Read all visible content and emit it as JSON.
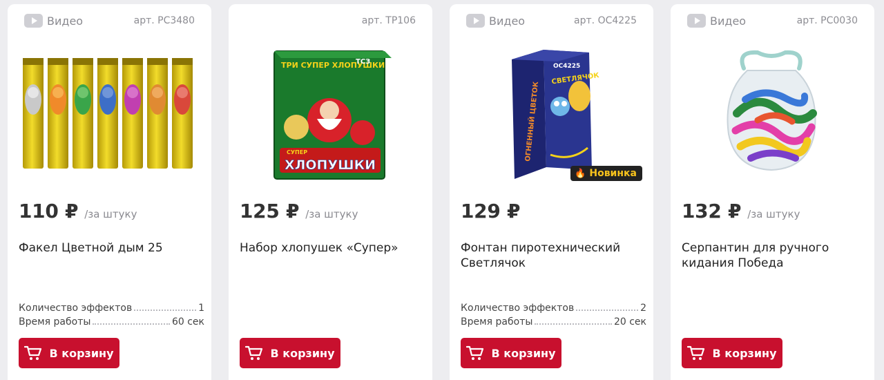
{
  "products": [
    {
      "video_label": "Видео",
      "has_video": true,
      "article": "арт. РС3480",
      "price": "110 ₽",
      "per_unit": "/за штуку",
      "title": "Факел Цветной дым 25",
      "specs": [
        {
          "label": "Количество эффектов",
          "value": "1"
        },
        {
          "label": "Время работы",
          "value": "60 сек"
        }
      ],
      "cart_label": "В корзину",
      "image_icon": "smoke-torches-image"
    },
    {
      "video_label": "",
      "has_video": false,
      "article": "арт. ТР106",
      "price": "125 ₽",
      "per_unit": "/за штуку",
      "title": "Набор хлопушек «Супер»",
      "specs": [],
      "cart_label": "В корзину",
      "image_icon": "party-poppers-box-image",
      "image_text": {
        "top": "ТРИ СУПЕР ХЛОПУШКИ",
        "brand": "ТСЗ",
        "bottom": "ХЛОПУШКИ",
        "sub": "СУПЕР"
      }
    },
    {
      "video_label": "Видео",
      "has_video": true,
      "article": "арт. ОС4225",
      "price": "129 ₽",
      "per_unit": "",
      "title": "Фонтан пиротехнический Светлячок",
      "badge": "Новинка",
      "specs": [
        {
          "label": "Количество эффектов",
          "value": "2"
        },
        {
          "label": "Время работы",
          "value": "20 сек"
        }
      ],
      "cart_label": "В корзину",
      "image_icon": "fountain-box-image",
      "image_text": {
        "code": "ОС4225",
        "name": "СВЕТЛЯЧОК",
        "side": "ОГНЕННЫЙ ЦВЕТОК"
      }
    },
    {
      "video_label": "Видео",
      "has_video": true,
      "article": "арт. РС0030",
      "price": "132 ₽",
      "per_unit": "/за штуку",
      "title": "Серпантин для ручного кидания Победа",
      "specs": [],
      "cart_label": "В корзину",
      "image_icon": "serpentine-bag-image"
    }
  ],
  "colors": {
    "accent": "#c8102e",
    "page_bg": "#ededf0",
    "card_bg": "#ffffff",
    "badge_text": "#f7c21c"
  }
}
